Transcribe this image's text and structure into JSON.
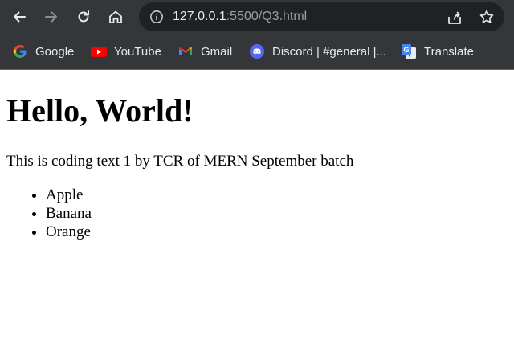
{
  "browser": {
    "url_host": "127.0.0.1",
    "url_rest": ":5500/Q3.html",
    "bookmarks": [
      {
        "label": "Google",
        "icon": "google-icon"
      },
      {
        "label": "YouTube",
        "icon": "youtube-icon"
      },
      {
        "label": "Gmail",
        "icon": "gmail-icon"
      },
      {
        "label": "Discord | #general |...",
        "icon": "discord-icon"
      },
      {
        "label": "Translate",
        "icon": "translate-icon"
      }
    ]
  },
  "page": {
    "heading": "Hello, World!",
    "paragraph": "This is coding text 1 by TCR of MERN September batch",
    "list_items": [
      "Apple",
      "Banana",
      "Orange"
    ]
  },
  "colors": {
    "toolbar_bg": "#35363a",
    "omnibox_bg": "#202124",
    "text_light": "#e8eaed",
    "text_dim": "#9aa0a6"
  }
}
